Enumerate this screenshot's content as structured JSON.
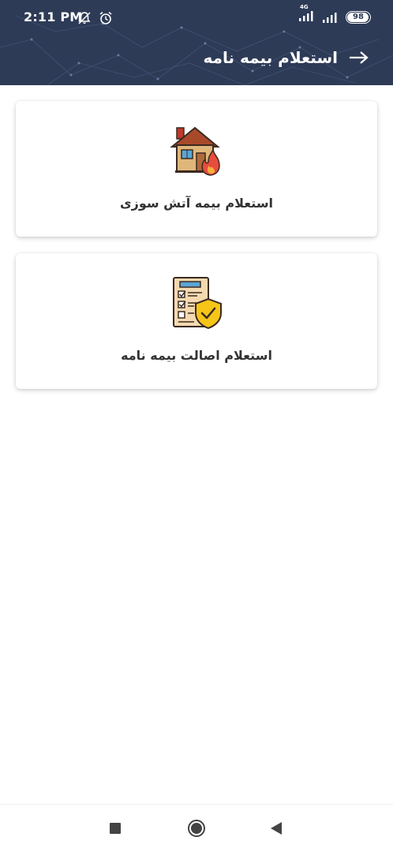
{
  "status_bar": {
    "time": "2:11 PM",
    "network_label": "4G",
    "battery_level": "98",
    "icons": [
      "notifications-off-icon",
      "alarm-icon",
      "signal-icon",
      "signal-icon",
      "battery-icon"
    ]
  },
  "header": {
    "title": "استعلام بیمه نامه",
    "back_icon": "arrow-right-icon",
    "background_color": "#2e3b57"
  },
  "cards": [
    {
      "label": "استعلام بیمه آتش سوزی",
      "icon": "house-fire-icon"
    },
    {
      "label": "استعلام اصالت بیمه نامه",
      "icon": "insurance-document-shield-icon"
    }
  ],
  "nav_bar": {
    "buttons": [
      "recents-square-icon",
      "home-circle-icon",
      "back-triangle-icon"
    ]
  }
}
